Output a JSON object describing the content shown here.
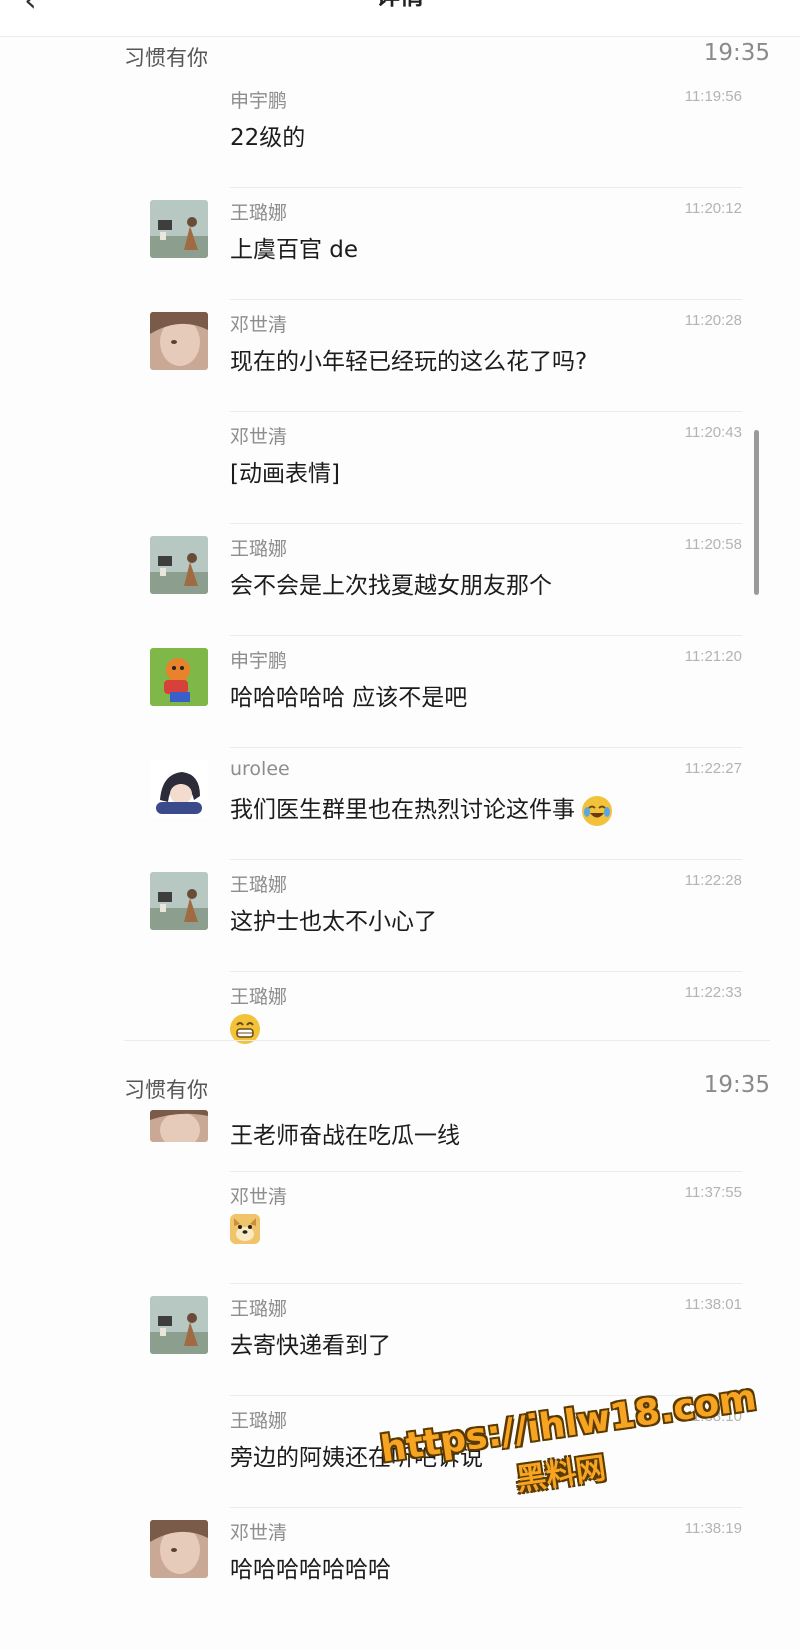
{
  "header": {
    "title": "详情",
    "back_icon": "chevron-left-icon"
  },
  "sections": [
    {
      "name": "习惯有你",
      "time": "19:35",
      "messages": [
        {
          "sender": "申宇鹏",
          "time": "11:19:56",
          "text": "22级的",
          "avatar": "none"
        },
        {
          "sender": "王璐娜",
          "time": "11:20:12",
          "text": "上虞百官 de",
          "avatar": "landscape-avatar"
        },
        {
          "sender": "邓世清",
          "time": "11:20:28",
          "text": "现在的小年轻已经玩的这么花了吗?",
          "avatar": "portrait-avatar"
        },
        {
          "sender": "邓世清",
          "time": "11:20:43",
          "text": "[动画表情]",
          "avatar": "none"
        },
        {
          "sender": "王璐娜",
          "time": "11:20:58",
          "text": "会不会是上次找夏越女朋友那个",
          "avatar": "landscape-avatar"
        },
        {
          "sender": "申宇鹏",
          "time": "11:21:20",
          "text": "哈哈哈哈哈 应该不是吧",
          "avatar": "cartoon-avatar"
        },
        {
          "sender": "urolee",
          "time": "11:22:27",
          "text": "我们医生群里也在热烈讨论这件事",
          "emoji": "laugh-cry-emoji",
          "avatar": "anime-avatar"
        },
        {
          "sender": "王璐娜",
          "time": "11:22:28",
          "text": "这护士也太不小心了",
          "avatar": "landscape-avatar"
        },
        {
          "sender": "王璐娜",
          "time": "11:22:33",
          "text": "",
          "emoji": "grin-emoji",
          "avatar": "none"
        }
      ]
    },
    {
      "name": "习惯有你",
      "time": "19:35",
      "messages": [
        {
          "sender": "",
          "time": "",
          "text": "王老师奋战在吃瓜一线",
          "avatar": "portrait-avatar"
        },
        {
          "sender": "邓世清",
          "time": "11:37:55",
          "text": "",
          "emoji": "doge-emoji",
          "avatar": "none"
        },
        {
          "sender": "王璐娜",
          "time": "11:38:01",
          "text": "去寄快递看到了",
          "avatar": "landscape-avatar"
        },
        {
          "sender": "王璐娜",
          "time": "11:38:10",
          "text": "旁边的阿姨还在听吧诉说",
          "avatar": "none"
        },
        {
          "sender": "邓世清",
          "time": "11:38:19",
          "text": "哈哈哈哈哈哈哈",
          "avatar": "portrait-avatar"
        }
      ]
    }
  ],
  "watermark": {
    "url": "https://ihlw18.com",
    "label": "黑料网"
  },
  "colors": {
    "accent": "#f7a423",
    "divider": "#ececec",
    "timestamp": "#b3b3b3"
  }
}
